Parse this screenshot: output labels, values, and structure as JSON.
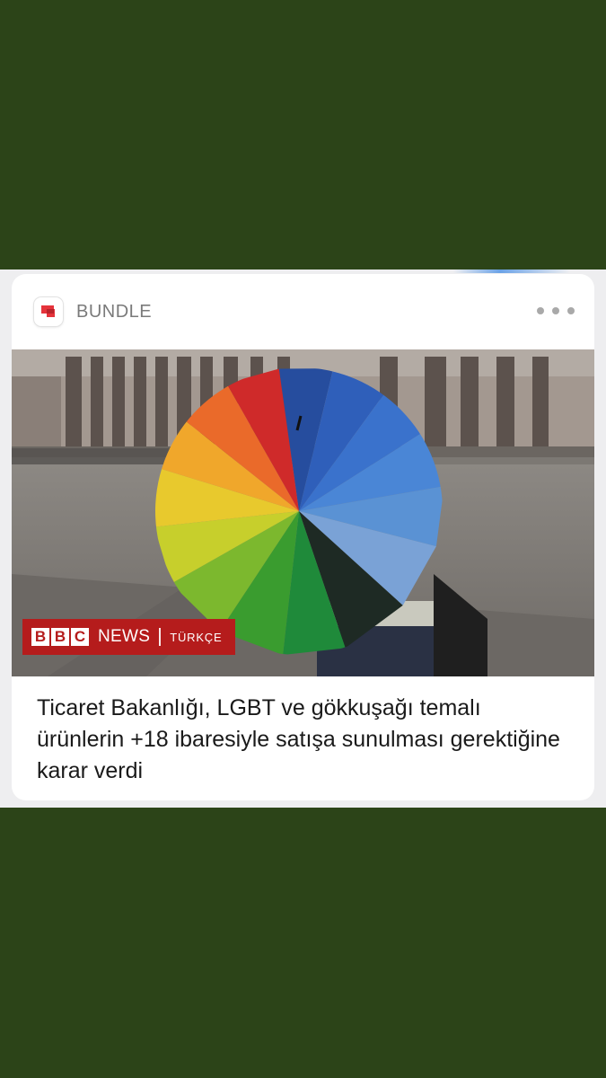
{
  "notification": {
    "source": "BUNDLE",
    "headline": "Ticaret Bakanlığı, LGBT ve gökkuşağı temalı ürünlerin +18 ibaresiyle satışa sunulması gerektiğine karar verdi",
    "more_icon": "more-horizontal-icon",
    "app_icon": "bundle-logo-icon"
  },
  "image": {
    "badge": {
      "letters": [
        "B",
        "B",
        "C"
      ],
      "news": "NEWS",
      "language": "TÜRKÇE"
    }
  },
  "colors": {
    "background": "#2c4418",
    "card": "#ffffff",
    "badge_red": "#b51c1c",
    "brand_red": "#e5333b"
  }
}
